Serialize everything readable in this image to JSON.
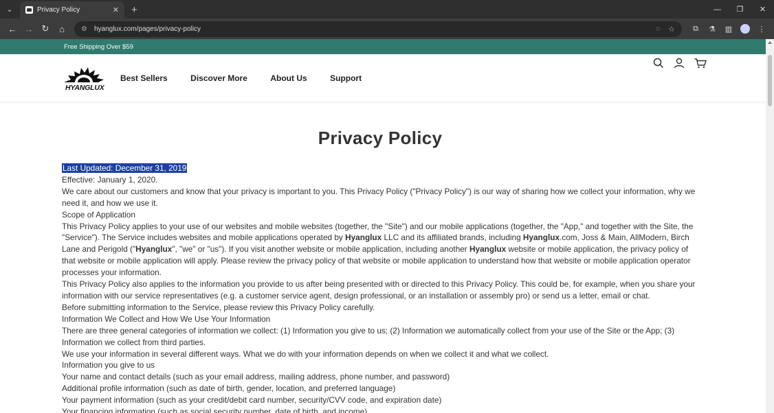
{
  "browser": {
    "tab_title": "Privacy Policy",
    "url": "hyanglux.com/pages/privacy-policy"
  },
  "promo": {
    "text": "Free Shipping Over $59"
  },
  "brand": {
    "logo_text": "HYANGLUX"
  },
  "nav": {
    "items": [
      "Best Sellers",
      "Discover More",
      "About Us",
      "Support"
    ]
  },
  "page": {
    "title": "Privacy Policy",
    "highlight": "Last Updated: December 31, 2019",
    "p1": "Effective: January 1, 2020.",
    "p2": "We care about our customers and know that your privacy is important to you. This Privacy Policy (\"Privacy Policy\") is our way of sharing how we collect your information, why we need it, and how we use it.",
    "p3": "Scope of Application",
    "p4a": "This Privacy Policy applies to your use of our websites and mobile websites (together, the \"Site\") and our mobile applications (together, the \"App,\" and together with the Site, the \"Service\"). The Service includes websites and mobile applications operated by ",
    "brand_name": "Hyanglux",
    "p4b": " LLC and its affiliated brands, including ",
    "p4c": ".com, Joss & Main, AllModern, Birch Lane and Perigold (\"",
    "p4d": "\", \"we\" or \"us\"). If you visit another website or mobile application, including another ",
    "p4e": " website or mobile application, the privacy policy of that website or mobile application will apply. Please review the privacy policy of that website or mobile application to understand how that website or mobile application operator processes your information.",
    "p5": "This Privacy Policy also applies to the information you provide to us after being presented with or directed to this Privacy Policy. This could be, for example, when you share your information with our service representatives (e.g. a customer service agent, design professional, or an installation or assembly pro) or send us a letter, email or chat.",
    "p6": "Before submitting information to the Service, please review this Privacy Policy carefully.",
    "p7": "Information We Collect and How We Use Your Information",
    "p8": "There are three general categories of information we collect: (1) Information you give to us; (2) Information we automatically collect from your use of the Site or the App; (3) Information we collect from third parties.",
    "p9": "We use your information in several different ways. What we do with your information depends on when we collect it and what we collect.",
    "p10": "Information you give to us",
    "p11": "Your name and contact details (such as your email address, mailing address, phone number, and password)",
    "p12": "Additional profile information (such as date of birth, gender, location, and preferred language)",
    "p13": "Your payment information (such as your credit/debit card number, security/CVV code, and expiration date)",
    "p14": "Your financing information (such as social security number, date of birth, and income)"
  }
}
